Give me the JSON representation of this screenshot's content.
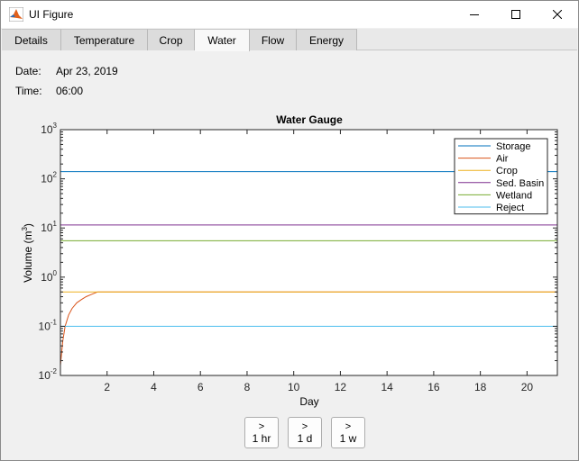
{
  "window": {
    "title": "UI Figure"
  },
  "tabs": [
    {
      "label": "Details",
      "active": false
    },
    {
      "label": "Temperature",
      "active": false
    },
    {
      "label": "Crop",
      "active": false
    },
    {
      "label": "Water",
      "active": true
    },
    {
      "label": "Flow",
      "active": false
    },
    {
      "label": "Energy",
      "active": false
    }
  ],
  "info": {
    "date_label": "Date:",
    "date_value": "Apr 23, 2019",
    "time_label": "Time:",
    "time_value": "06:00"
  },
  "chart_data": {
    "type": "line",
    "title": "Water Gauge",
    "xlabel": "Day",
    "ylabel": "Volume  (m",
    "ylabel_superscript": "3",
    "ylabel_close": ")",
    "xlim": [
      0,
      21.3
    ],
    "ylim": [
      0.01,
      1000
    ],
    "yscale": "log",
    "grid": false,
    "legend_position": "top-right",
    "xticks": [
      2,
      4,
      6,
      8,
      10,
      12,
      14,
      16,
      18,
      20
    ],
    "xtick_labels": [
      "2",
      "4",
      "6",
      "8",
      "10",
      "12",
      "14",
      "16",
      "18",
      "20"
    ],
    "yticks": [
      {
        "value": 0.01,
        "base": "10",
        "exp": "-2"
      },
      {
        "value": 0.1,
        "base": "10",
        "exp": "-1"
      },
      {
        "value": 1,
        "base": "10",
        "exp": "0"
      },
      {
        "value": 10,
        "base": "10",
        "exp": "1"
      },
      {
        "value": 100,
        "base": "10",
        "exp": "2"
      },
      {
        "value": 1000,
        "base": "10",
        "exp": "3"
      }
    ],
    "series": [
      {
        "name": "Storage",
        "color": "#0072bd",
        "x": [
          0,
          21.3
        ],
        "y": [
          140,
          140
        ]
      },
      {
        "name": "Air",
        "color": "#d95319",
        "x": [
          0,
          0.1,
          0.2,
          0.35,
          0.5,
          0.7,
          0.9,
          1.1,
          1.3,
          1.5,
          1.6,
          21.3
        ],
        "y": [
          0.016,
          0.05,
          0.1,
          0.17,
          0.23,
          0.3,
          0.35,
          0.4,
          0.44,
          0.48,
          0.5,
          0.5
        ]
      },
      {
        "name": "Crop",
        "color": "#edb120",
        "x": [
          0,
          21.3
        ],
        "y": [
          0.5,
          0.5
        ]
      },
      {
        "name": "Sed. Basin",
        "color": "#7e2f8e",
        "x": [
          0,
          21.3
        ],
        "y": [
          11.5,
          11.5
        ]
      },
      {
        "name": "Wetland",
        "color": "#77ac30",
        "x": [
          0,
          21.3
        ],
        "y": [
          5.5,
          5.5
        ]
      },
      {
        "name": "Reject",
        "color": "#4dbeee",
        "x": [
          0,
          21.3
        ],
        "y": [
          0.1,
          0.1
        ]
      }
    ]
  },
  "buttons": [
    {
      "arrow": ">",
      "label": "1 hr"
    },
    {
      "arrow": ">",
      "label": "1 d"
    },
    {
      "arrow": ">",
      "label": "1 w"
    }
  ]
}
